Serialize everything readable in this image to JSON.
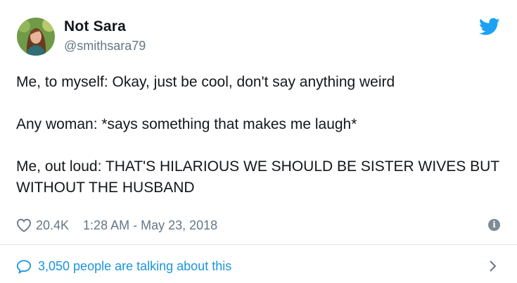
{
  "author": {
    "name": "Not Sara",
    "handle": "@smithsara79"
  },
  "tweet": {
    "lines": [
      "Me, to myself: Okay, just be cool, don't say anything weird",
      "Any woman: *says something that makes me laugh*",
      "Me, out loud: THAT'S HILARIOUS WE SHOULD BE SISTER WIVES BUT WITHOUT THE HUSBAND"
    ]
  },
  "meta": {
    "likes": "20.4K",
    "timestamp": "1:28 AM - May 23, 2018"
  },
  "conversation": {
    "label": "3,050 people are talking about this"
  },
  "colors": {
    "brand": "#1da1f2",
    "link": "#1b95e0",
    "secondary_text": "#657786"
  },
  "icons": {
    "brand": "twitter-bird-icon",
    "like": "heart-icon",
    "info": "info-icon",
    "reply": "speech-bubble-icon",
    "more": "chevron-right-icon"
  }
}
